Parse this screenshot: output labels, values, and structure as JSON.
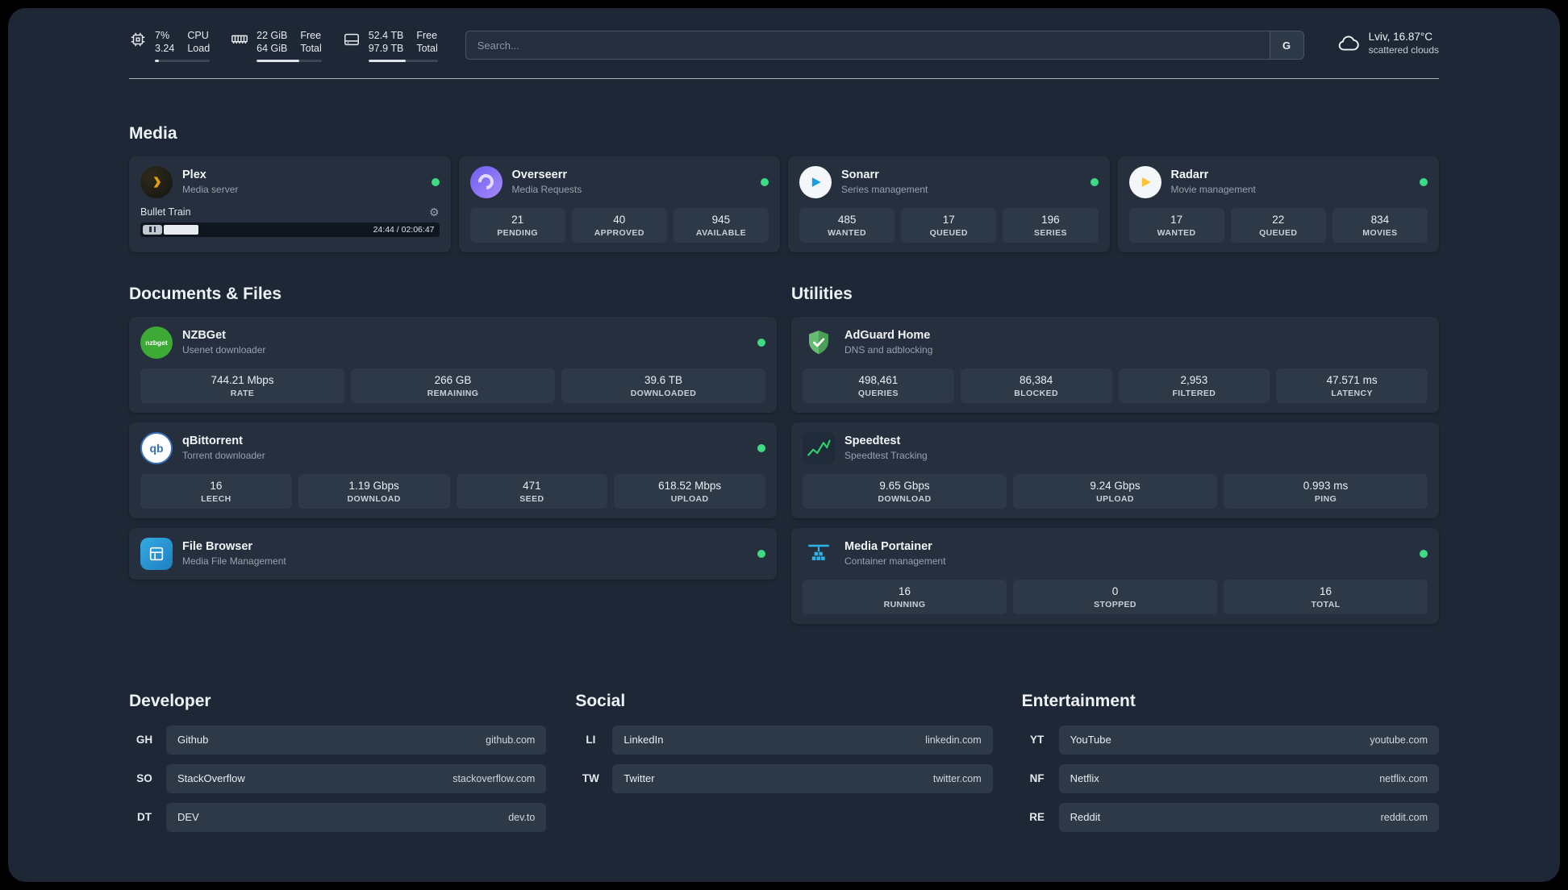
{
  "colors": {
    "panel_bg": "#1d2735",
    "card_bg": "#262f3e",
    "stat_bg": "#2e3948",
    "online_green": "#3ddc84",
    "plex_amber": "#e5a00d"
  },
  "topbar": {
    "metrics": [
      {
        "name": "cpu",
        "values": [
          "7%",
          "3.24"
        ],
        "labels": [
          "CPU",
          "Load"
        ],
        "usage": 7
      },
      {
        "name": "ram",
        "values": [
          "22 GiB",
          "64 GiB"
        ],
        "labels": [
          "Free",
          "Total"
        ],
        "usage": 66
      },
      {
        "name": "disk",
        "values": [
          "52.4 TB",
          "97.9 TB"
        ],
        "labels": [
          "Free",
          "Total"
        ],
        "usage": 54
      }
    ],
    "search": {
      "placeholder": "Search...",
      "engine_button": "G"
    },
    "weather": {
      "location": "Lviv, 16.87°C",
      "condition": "scattered clouds"
    }
  },
  "sections": {
    "media": {
      "title": "Media",
      "apps": [
        {
          "name": "Plex",
          "subtitle": "Media server",
          "online": true,
          "player": {
            "track": "Bullet Train",
            "time": "24:44 / 02:06:47",
            "progress_percent": 12
          }
        },
        {
          "name": "Overseerr",
          "subtitle": "Media Requests",
          "online": true,
          "stats": [
            {
              "value": "21",
              "label": "PENDING"
            },
            {
              "value": "40",
              "label": "APPROVED"
            },
            {
              "value": "945",
              "label": "AVAILABLE"
            }
          ]
        },
        {
          "name": "Sonarr",
          "subtitle": "Series management",
          "online": true,
          "stats": [
            {
              "value": "485",
              "label": "WANTED"
            },
            {
              "value": "17",
              "label": "QUEUED"
            },
            {
              "value": "196",
              "label": "SERIES"
            }
          ]
        },
        {
          "name": "Radarr",
          "subtitle": "Movie management",
          "online": true,
          "stats": [
            {
              "value": "17",
              "label": "WANTED"
            },
            {
              "value": "22",
              "label": "QUEUED"
            },
            {
              "value": "834",
              "label": "MOVIES"
            }
          ]
        }
      ]
    },
    "documents": {
      "title": "Documents & Files",
      "apps": [
        {
          "name": "NZBGet",
          "subtitle": "Usenet downloader",
          "online": true,
          "icon_text": "nzbget",
          "stats": [
            {
              "value": "744.21 Mbps",
              "label": "RATE"
            },
            {
              "value": "266 GB",
              "label": "REMAINING"
            },
            {
              "value": "39.6 TB",
              "label": "DOWNLOADED"
            }
          ]
        },
        {
          "name": "qBittorrent",
          "subtitle": "Torrent downloader",
          "online": true,
          "icon_text": "qb",
          "stats": [
            {
              "value": "16",
              "label": "LEECH"
            },
            {
              "value": "1.19 Gbps",
              "label": "DOWNLOAD"
            },
            {
              "value": "471",
              "label": "SEED"
            },
            {
              "value": "618.52 Mbps",
              "label": "UPLOAD"
            }
          ]
        },
        {
          "name": "File Browser",
          "subtitle": "Media File Management",
          "online": true
        }
      ]
    },
    "utilities": {
      "title": "Utilities",
      "apps": [
        {
          "name": "AdGuard Home",
          "subtitle": "DNS and adblocking",
          "online": false,
          "stats": [
            {
              "value": "498,461",
              "label": "QUERIES"
            },
            {
              "value": "86,384",
              "label": "BLOCKED"
            },
            {
              "value": "2,953",
              "label": "FILTERED"
            },
            {
              "value": "47.571 ms",
              "label": "LATENCY"
            }
          ]
        },
        {
          "name": "Speedtest",
          "subtitle": "Speedtest Tracking",
          "online": false,
          "stats": [
            {
              "value": "9.65 Gbps",
              "label": "DOWNLOAD"
            },
            {
              "value": "9.24 Gbps",
              "label": "UPLOAD"
            },
            {
              "value": "0.993 ms",
              "label": "PING"
            }
          ]
        },
        {
          "name": "Media Portainer",
          "subtitle": "Container management",
          "online": true,
          "stats": [
            {
              "value": "16",
              "label": "RUNNING"
            },
            {
              "value": "0",
              "label": "STOPPED"
            },
            {
              "value": "16",
              "label": "TOTAL"
            }
          ]
        }
      ]
    },
    "bookmarks": [
      {
        "title": "Developer",
        "items": [
          {
            "abbr": "GH",
            "name": "Github",
            "url": "github.com"
          },
          {
            "abbr": "SO",
            "name": "StackOverflow",
            "url": "stackoverflow.com"
          },
          {
            "abbr": "DT",
            "name": "DEV",
            "url": "dev.to"
          }
        ]
      },
      {
        "title": "Social",
        "items": [
          {
            "abbr": "LI",
            "name": "LinkedIn",
            "url": "linkedin.com"
          },
          {
            "abbr": "TW",
            "name": "Twitter",
            "url": "twitter.com"
          }
        ]
      },
      {
        "title": "Entertainment",
        "items": [
          {
            "abbr": "YT",
            "name": "YouTube",
            "url": "youtube.com"
          },
          {
            "abbr": "NF",
            "name": "Netflix",
            "url": "netflix.com"
          },
          {
            "abbr": "RE",
            "name": "Reddit",
            "url": "reddit.com"
          }
        ]
      }
    ]
  }
}
